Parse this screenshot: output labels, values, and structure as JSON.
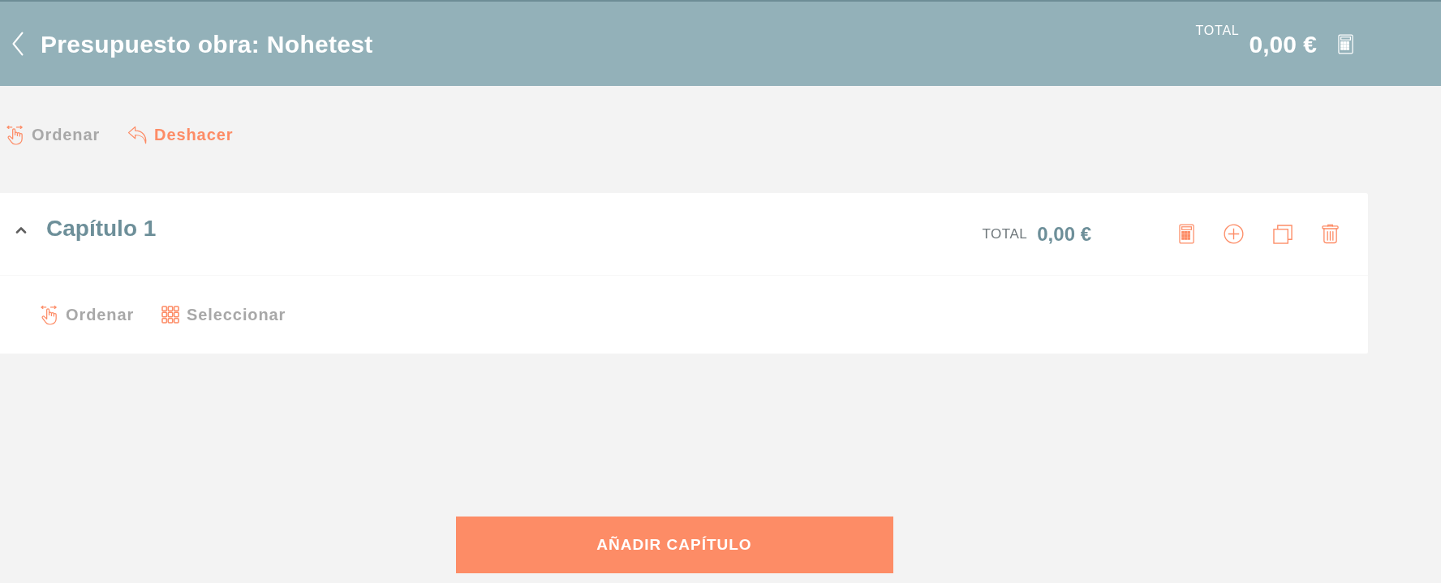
{
  "header": {
    "title_label": "Presupuesto obra:",
    "title_name": "Nohetest",
    "total_label": "TOTAL",
    "total_value": "0,00 €"
  },
  "toolbar": [
    {
      "kind": "sort",
      "label": "Ordenar",
      "disabled": true
    },
    {
      "kind": "undo",
      "label": "Deshacer",
      "disabled": false
    }
  ],
  "chapters": [
    {
      "title": "Capítulo 1",
      "expanded": true,
      "total_label": "TOTAL",
      "total_value": "0,00 €",
      "tools": [
        {
          "kind": "sort",
          "label": "Ordenar",
          "disabled": true
        },
        {
          "kind": "select",
          "label": "Seleccionar",
          "disabled": true
        }
      ]
    }
  ],
  "add_button": "AÑADIR CAPÍTULO"
}
